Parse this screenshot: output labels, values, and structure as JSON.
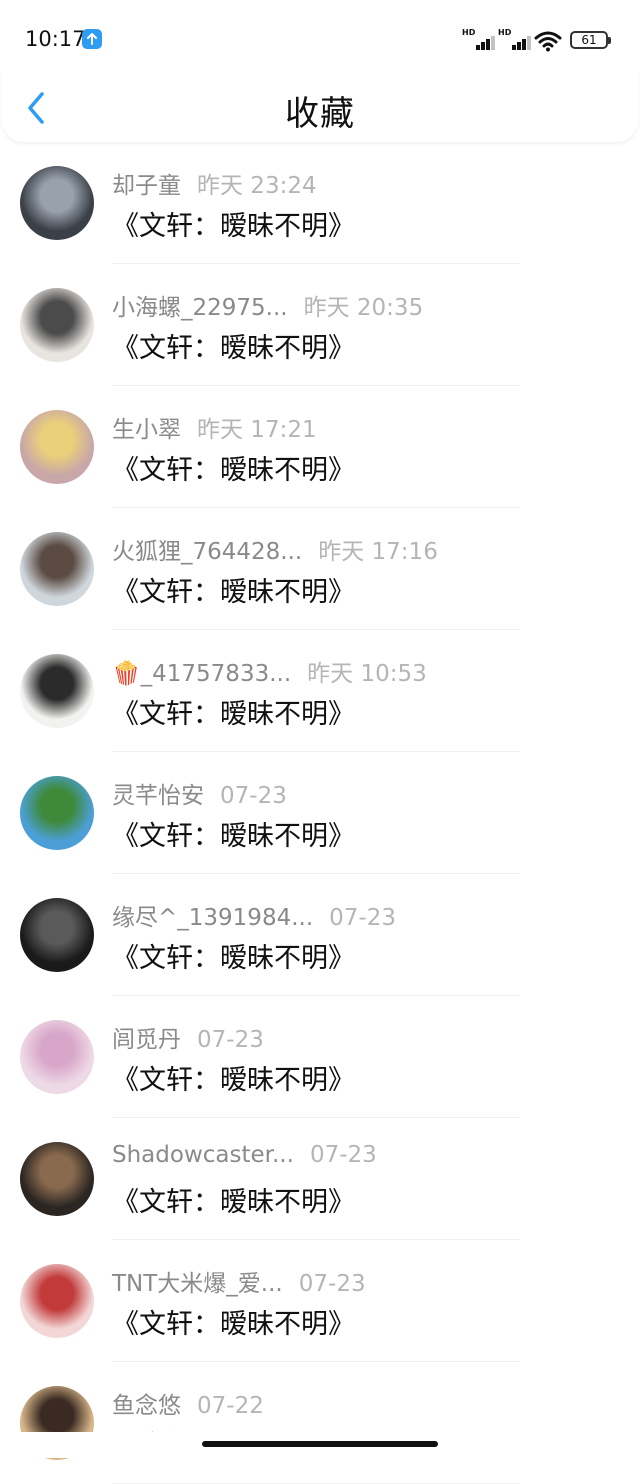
{
  "status_bar": {
    "time": "10:17",
    "battery": "61",
    "sim1_tag": "HD",
    "sim2_tag": "HD",
    "icons": [
      "upload-icon",
      "signal-icon",
      "signal-icon",
      "wifi-icon",
      "battery-icon"
    ]
  },
  "header": {
    "title": "收藏",
    "back_icon": "chevron-left-icon",
    "accent_color": "#2d9cf2"
  },
  "items": [
    {
      "name": "却子童",
      "time": "昨天 23:24",
      "title": "《文轩：暧昧不明》",
      "avatar_colors": [
        "#3b3f47",
        "#99a1ad"
      ]
    },
    {
      "name": "小海螺_22975...",
      "time": "昨天 20:35",
      "title": "《文轩：暧昧不明》",
      "avatar_colors": [
        "#e8e4e0",
        "#4b4b4b"
      ]
    },
    {
      "name": "生小翠",
      "time": "昨天 17:21",
      "title": "《文轩：暧昧不明》",
      "avatar_colors": [
        "#c9a7a8",
        "#e9d07a"
      ]
    },
    {
      "name": "火狐狸_764428...",
      "time": "昨天 17:16",
      "title": "《文轩：暧昧不明》",
      "avatar_colors": [
        "#cfd6dc",
        "#5b4b42"
      ]
    },
    {
      "name": "🍿_41757833...",
      "time": "昨天 10:53",
      "title": "《文轩：暧昧不明》",
      "avatar_colors": [
        "#f2f2f0",
        "#2b2b2b"
      ]
    },
    {
      "name": "灵芊怡安",
      "time": "07-23",
      "title": "《文轩：暧昧不明》",
      "avatar_colors": [
        "#4c9fd6",
        "#3e8a3a"
      ]
    },
    {
      "name": "缘尽^_1391984...",
      "time": "07-23",
      "title": "《文轩：暧昧不明》",
      "avatar_colors": [
        "#1a1a1a",
        "#5a5a5a"
      ]
    },
    {
      "name": "闾觅丹",
      "time": "07-23",
      "title": "《文轩：暧昧不明》",
      "avatar_colors": [
        "#eed9e6",
        "#d8a6c9"
      ]
    },
    {
      "name": "Shadowcaster...",
      "time": "07-23",
      "title": "《文轩：暧昧不明》",
      "avatar_colors": [
        "#2b2622",
        "#8a6a4e"
      ]
    },
    {
      "name": "TNT大米爆_爱...",
      "time": "07-23",
      "title": "《文轩：暧昧不明》",
      "avatar_colors": [
        "#f3d7d7",
        "#c23a3a"
      ]
    },
    {
      "name": "鱼念悠",
      "time": "07-22",
      "title": "《文轩：暧昧不明》",
      "avatar_colors": [
        "#d9b78a",
        "#3a2a22"
      ]
    }
  ]
}
